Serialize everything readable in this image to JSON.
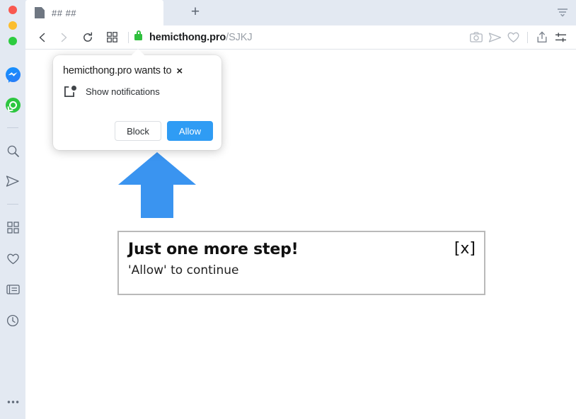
{
  "window": {
    "traffic_lights": [
      {
        "name": "close",
        "color": "#f9584f"
      },
      {
        "name": "minimize",
        "color": "#fbbd2e"
      },
      {
        "name": "maximize",
        "color": "#2dcc3f"
      }
    ]
  },
  "sidebar": {
    "background": "#e3e9f2",
    "items": [
      {
        "icon": "messenger-icon",
        "label": "Messenger"
      },
      {
        "icon": "whatsapp-icon",
        "label": "WhatsApp"
      },
      {
        "icon": "divider",
        "label": ""
      },
      {
        "icon": "search-icon",
        "label": "Search"
      },
      {
        "icon": "telegram-send-icon",
        "label": "Telegram"
      },
      {
        "icon": "divider",
        "label": ""
      },
      {
        "icon": "grid-apps-icon",
        "label": "Apps"
      },
      {
        "icon": "heart-icon",
        "label": "Bookmarks"
      },
      {
        "icon": "notes-icon",
        "label": "Notes"
      },
      {
        "icon": "clock-history-icon",
        "label": "History"
      },
      {
        "icon": "more-dots-icon",
        "label": "More"
      }
    ]
  },
  "tabstrip": {
    "tabs": [
      {
        "title": "## ##",
        "favicon": "page-icon",
        "active": true
      }
    ],
    "new_tab_label": "+",
    "tab_menu_icon": "tab-list-icon"
  },
  "toolbar": {
    "back_icon": "chevron-left-icon",
    "forward_icon": "chevron-right-icon",
    "reload_icon": "reload-icon",
    "panel_icon": "grid-panel-icon",
    "security_icon": "lock-icon",
    "security_color": "#2fbf3d",
    "url_host": "hemicthong.pro",
    "url_path": "/SJKJ",
    "right_icons": [
      {
        "icon": "camera-icon",
        "label": "Capture page"
      },
      {
        "icon": "paper-plane-icon",
        "label": "Send"
      },
      {
        "icon": "heart-icon",
        "label": "Add bookmark"
      },
      {
        "icon": "share-upload-icon",
        "label": "Share"
      },
      {
        "icon": "sliders-settings-icon",
        "label": "Page actions"
      }
    ]
  },
  "permission_popup": {
    "title": "hemicthong.pro wants to",
    "close_label": "×",
    "permission_icon": "notification-badge-icon",
    "permission_label": "Show notifications",
    "block_label": "Block",
    "allow_label": "Allow",
    "allow_color": "#2f9cf4"
  },
  "page": {
    "arrow_icon": "up-arrow",
    "arrow_color": "#3a94f0",
    "notice_title": "Just one more step!",
    "notice_subtitle": "'Allow' to continue",
    "notice_close": "[x]",
    "notice_border_color": "#b9b9b9"
  }
}
